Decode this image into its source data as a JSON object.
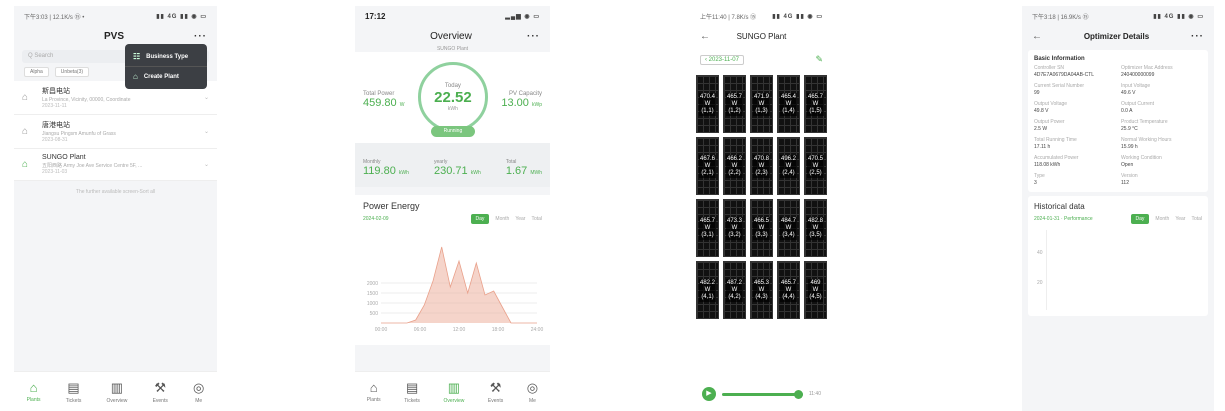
{
  "phone1": {
    "status": {
      "time": "下午3:03 | 12.1K/s ⑮ •",
      "icons": "▮▮ 4G ▮▮ ◉ ▭"
    },
    "title": "PVS",
    "more": "···",
    "search_placeholder": "Q Search",
    "filters": [
      "Alpha",
      "Unbeta(3)"
    ],
    "plants": [
      {
        "name": "斯昌电站",
        "addr": "La Province, Vicinity, 00000, Coordinate",
        "date": "2023-11-11"
      },
      {
        "name": "唐港电站",
        "addr": "Jiangsu Pingsm Amunfu of Grass",
        "date": "2023-08-31"
      },
      {
        "name": "SUNGO Plant",
        "addr": "五阳西路 Army Joe Ave Service Centre 5F, ...",
        "date": "2023-11-03"
      }
    ],
    "no_more": "The further available screen-Sort all",
    "popup": [
      {
        "icon": "grid-icon",
        "label": "Business Type"
      },
      {
        "icon": "plant-icon",
        "label": "Create Plant"
      }
    ],
    "tabs": [
      "Plants",
      "Tickets",
      "Overview",
      "Events",
      "Me"
    ],
    "active_tab": "Plants"
  },
  "phone2": {
    "status": {
      "time": "17:12",
      "icons": "▂▄▆ ◉ ▭"
    },
    "title": "Overview",
    "more": "···",
    "plant": "SUNGO Plant",
    "total_power_label": "Total Power",
    "total_power_value": "459.80",
    "total_power_unit": "W",
    "today_label": "Today",
    "today_value": "22.52",
    "today_unit": "kWh",
    "running": "Running",
    "pv_capacity_label": "PV Capacity",
    "pv_capacity_value": "13.00",
    "pv_capacity_unit": "kWp",
    "monthly_label": "Monthly",
    "monthly_value": "119.80",
    "monthly_unit": "kWh",
    "yearly_label": "yearly",
    "yearly_value": "230.71",
    "yearly_unit": "kWh",
    "total_label": "Total",
    "total_value": "1.67",
    "total_unit": "MWh",
    "pe_title": "Power Energy",
    "pe_date": "2024-02-09",
    "segments": [
      "Day",
      "Month",
      "Year",
      "Total"
    ],
    "active_segment": "Day",
    "tabs": [
      "Plants",
      "Tickets",
      "Overview",
      "Events",
      "Me"
    ],
    "active_tab": "Overview"
  },
  "chart_data": {
    "type": "area",
    "x": [
      "00:00",
      "02:00",
      "04:00",
      "06:00",
      "08:00",
      "10:00",
      "11:00",
      "12:00",
      "12:30",
      "13:00",
      "13:30",
      "14:00",
      "14:30",
      "15:00",
      "16:00",
      "18:00",
      "20:00",
      "22:00",
      "24:00"
    ],
    "values": [
      0,
      0,
      0,
      0,
      150,
      900,
      2100,
      3800,
      1800,
      3100,
      1500,
      3000,
      1400,
      1600,
      800,
      0,
      0,
      0,
      0
    ],
    "xticks": [
      "00:00",
      "06:00",
      "12:00",
      "18:00",
      "24:00"
    ],
    "yticks": [
      "500",
      "1000",
      "1500",
      "2000"
    ],
    "ylim": [
      0,
      4000
    ],
    "color": "#e9a08a"
  },
  "phone3": {
    "status": {
      "time": "上午11:40 | 7.8K/s ⑮",
      "icons": "▮▮ 4G ▮▮ ◉ ▭"
    },
    "title": "SUNGO Plant",
    "date": "2023-11-07",
    "panels": [
      {
        "w": "470.4",
        "pos": "(1,1)"
      },
      {
        "w": "465.7",
        "pos": "(1,2)"
      },
      {
        "w": "471.9",
        "pos": "(1,3)"
      },
      {
        "w": "465.4",
        "pos": "(1,4)"
      },
      {
        "w": "465.7",
        "pos": "(1,5)"
      },
      {
        "w": "467.6",
        "pos": "(2,1)"
      },
      {
        "w": "466.2",
        "pos": "(2,2)"
      },
      {
        "w": "470.8",
        "pos": "(2,3)"
      },
      {
        "w": "496.2",
        "pos": "(2,4)"
      },
      {
        "w": "470.5",
        "pos": "(2,5)"
      },
      {
        "w": "465.7",
        "pos": "(3,1)"
      },
      {
        "w": "473.3",
        "pos": "(3,2)"
      },
      {
        "w": "466.5",
        "pos": "(3,3)"
      },
      {
        "w": "484.7",
        "pos": "(3,4)"
      },
      {
        "w": "482.8",
        "pos": "(3,5)"
      },
      {
        "w": "482.2",
        "pos": "(4,1)"
      },
      {
        "w": "487.2",
        "pos": "(4,2)"
      },
      {
        "w": "465.3",
        "pos": "(4,3)"
      },
      {
        "w": "465.7",
        "pos": "(4,4)"
      },
      {
        "w": "469",
        "pos": "(4,5)"
      }
    ],
    "unit": "W",
    "playback_time": "11:40"
  },
  "phone4": {
    "status": {
      "time": "下午3:18 | 16.9K/s ⑮",
      "icons": "▮▮ 4G ▮▮ ◉ ▭"
    },
    "title": "Optimizer Details",
    "more": "···",
    "basic_title": "Basic Information",
    "fields": [
      {
        "k": "Controller SN",
        "v": "4D7E7A0679DA04AB-CTL"
      },
      {
        "k": "Optimizer Mac Address",
        "v": "240400000099"
      },
      {
        "k": "Current Serial Number",
        "v": "99"
      },
      {
        "k": "Input Voltage",
        "v": "49.6 V"
      },
      {
        "k": "Output Voltage",
        "v": "49.8 V"
      },
      {
        "k": "Output Current",
        "v": "0.0 A"
      },
      {
        "k": "Output Power",
        "v": "2.5 W"
      },
      {
        "k": "Product Temperature",
        "v": "25.9 °C"
      },
      {
        "k": "Total Running Time",
        "v": "17.11 h"
      },
      {
        "k": "Normal Working Hours",
        "v": "15.99 h"
      },
      {
        "k": "Accumulated Power",
        "v": "118.08 kWh"
      },
      {
        "k": "Working Condition",
        "v": "Open"
      },
      {
        "k": "Type",
        "v": "3"
      },
      {
        "k": "Version",
        "v": "112"
      }
    ],
    "hist_title": "Historical data",
    "hist_date": "2024-01-31 · Performance",
    "segments": [
      "Day",
      "Month",
      "Year",
      "Total"
    ],
    "active_segment": "Day",
    "yticks": [
      "40",
      "20"
    ]
  }
}
